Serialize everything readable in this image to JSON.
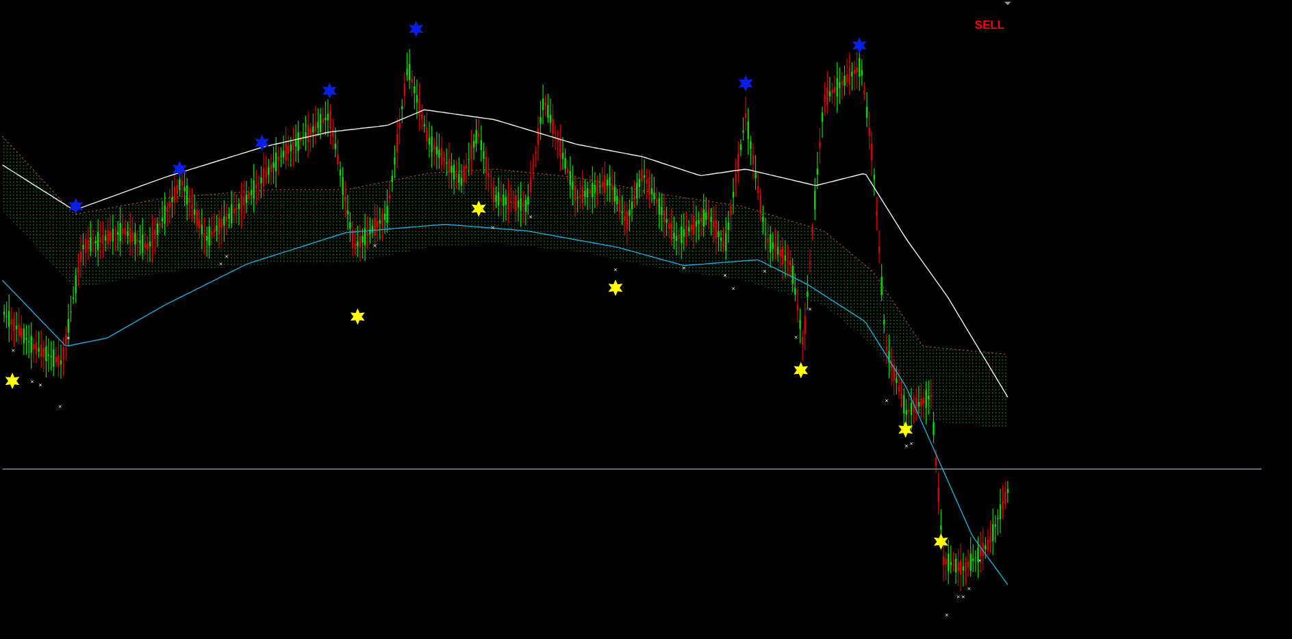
{
  "signal": {
    "label": "SELL",
    "kind": "sell"
  }
}
